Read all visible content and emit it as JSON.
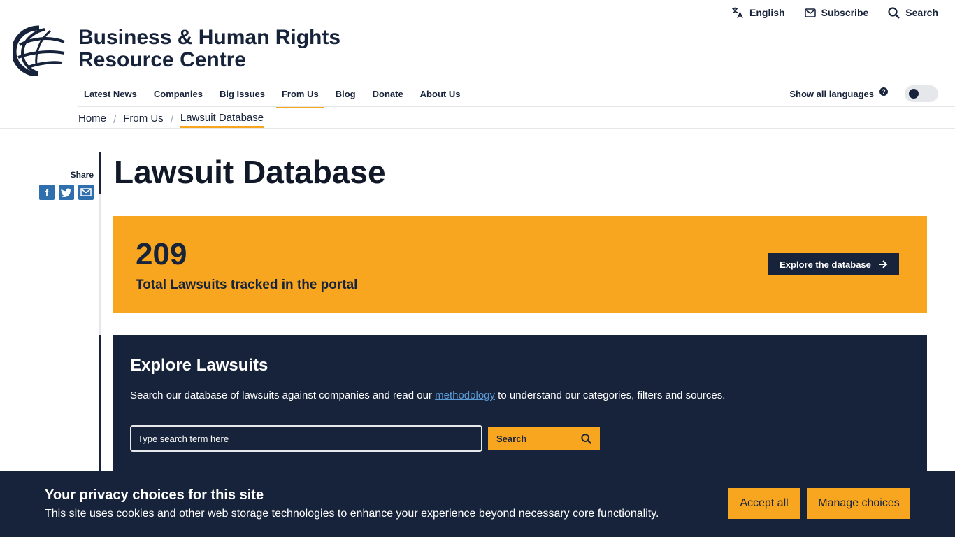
{
  "utility": {
    "language": "English",
    "subscribe": "Subscribe",
    "search": "Search"
  },
  "logo": {
    "line1": "Business & Human Rights",
    "line2": "Resource Centre"
  },
  "nav": {
    "items": [
      {
        "label": "Latest News"
      },
      {
        "label": "Companies"
      },
      {
        "label": "Big Issues"
      },
      {
        "label": "From Us"
      },
      {
        "label": "Blog"
      },
      {
        "label": "Donate"
      },
      {
        "label": "About Us"
      }
    ],
    "active": "From Us",
    "show_languages": "Show all languages"
  },
  "breadcrumb": [
    "Home",
    "From Us",
    "Lawsuit Database"
  ],
  "share": {
    "label": "Share"
  },
  "page": {
    "title": "Lawsuit Database"
  },
  "stats": {
    "number": "209",
    "label": "Total Lawsuits tracked in the portal",
    "button": "Explore the database"
  },
  "explore": {
    "heading": "Explore Lawsuits",
    "desc_before": "Search our database of lawsuits against companies and read our ",
    "desc_link": "methodology",
    "desc_after": " to understand our categories, filters and sources.",
    "placeholder": "Type search term here",
    "search_button": "Search"
  },
  "cookie": {
    "title": "Your privacy choices for this site",
    "text": "This site uses cookies and other web storage technologies to enhance your experience beyond necessary core functionality.",
    "accept": "Accept all",
    "manage": "Manage choices"
  },
  "colors": {
    "navy": "#17233a",
    "accent": "#f8a620",
    "link": "#5b9bd5",
    "share": "#2f6fad"
  }
}
